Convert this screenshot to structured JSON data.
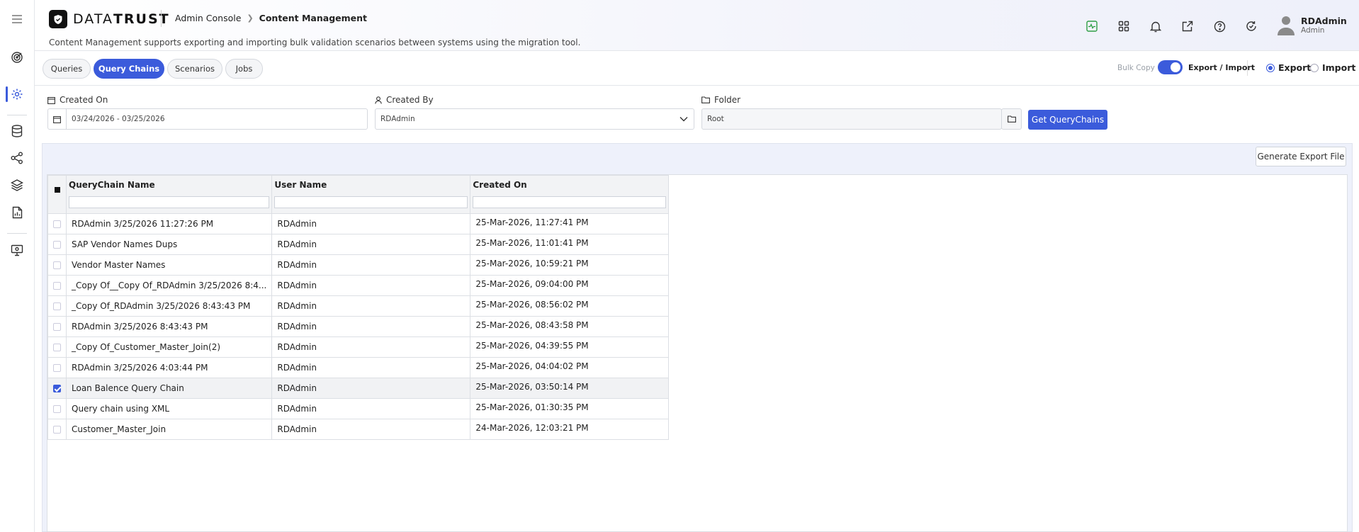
{
  "app": {
    "logo": "DATATRUST",
    "breadcrumb": [
      "Admin Console",
      "Content Management"
    ],
    "subtitle": "Content Management supports exporting and importing bulk validation scenarios between systems using the migration tool."
  },
  "header_icons": [
    "activity-icon",
    "apps-grid-icon",
    "bell-icon",
    "external-link-icon",
    "help-icon",
    "refresh-icon"
  ],
  "user": {
    "name": "RDAdmin",
    "role": "Admin"
  },
  "sidebar": [
    "menu-icon",
    "target-icon",
    "settings-icon",
    "database-icon",
    "share-nodes-icon",
    "layers-icon",
    "report-icon",
    "monitor-settings-icon"
  ],
  "tabs": [
    {
      "label": "Queries",
      "active": false
    },
    {
      "label": "Query Chains",
      "active": true
    },
    {
      "label": "Scenarios",
      "active": false
    },
    {
      "label": "Jobs",
      "active": false
    }
  ],
  "toolbar": {
    "bulk_copy": "Bulk Copy",
    "export_import": "Export / Import",
    "export": "Export",
    "import": "Import",
    "mode": "Export"
  },
  "filters": {
    "created_on_label": "Created On",
    "created_on_value": "03/24/2026 - 03/25/2026",
    "created_by_label": "Created By",
    "created_by_value": "RDAdmin",
    "folder_label": "Folder",
    "folder_value": "Root",
    "get_button": "Get QueryChains"
  },
  "grid": {
    "generate_button": "Generate Export File",
    "columns": [
      "QueryChain Name",
      "User Name",
      "Created On"
    ],
    "rows": [
      {
        "name": "RDAdmin 3/25/2026 11:27:26 PM",
        "user": "RDAdmin",
        "created": "25-Mar-2026, 11:27:41 PM",
        "checked": false
      },
      {
        "name": "SAP Vendor Names Dups",
        "user": "RDAdmin",
        "created": "25-Mar-2026, 11:01:41 PM",
        "checked": false
      },
      {
        "name": "Vendor Master Names",
        "user": "RDAdmin",
        "created": "25-Mar-2026, 10:59:21 PM",
        "checked": false
      },
      {
        "name": "_Copy Of__Copy Of_RDAdmin 3/25/2026 8:4...",
        "user": "RDAdmin",
        "created": "25-Mar-2026, 09:04:00 PM",
        "checked": false
      },
      {
        "name": "_Copy Of_RDAdmin 3/25/2026 8:43:43 PM",
        "user": "RDAdmin",
        "created": "25-Mar-2026, 08:56:02 PM",
        "checked": false
      },
      {
        "name": "RDAdmin 3/25/2026 8:43:43 PM",
        "user": "RDAdmin",
        "created": "25-Mar-2026, 08:43:58 PM",
        "checked": false
      },
      {
        "name": "_Copy Of_Customer_Master_Join(2)",
        "user": "RDAdmin",
        "created": "25-Mar-2026, 04:39:55 PM",
        "checked": false
      },
      {
        "name": "RDAdmin 3/25/2026 4:03:44 PM",
        "user": "RDAdmin",
        "created": "25-Mar-2026, 04:04:02 PM",
        "checked": false
      },
      {
        "name": "Loan Balence Query Chain",
        "user": "RDAdmin",
        "created": "25-Mar-2026, 03:50:14 PM",
        "checked": true
      },
      {
        "name": "Query chain using XML",
        "user": "RDAdmin",
        "created": "25-Mar-2026, 01:30:35 PM",
        "checked": false
      },
      {
        "name": "Customer_Master_Join",
        "user": "RDAdmin",
        "created": "24-Mar-2026, 12:03:21 PM",
        "checked": false
      }
    ]
  },
  "colors": {
    "accent": "#3b5bdb",
    "success": "#2f9e44"
  }
}
